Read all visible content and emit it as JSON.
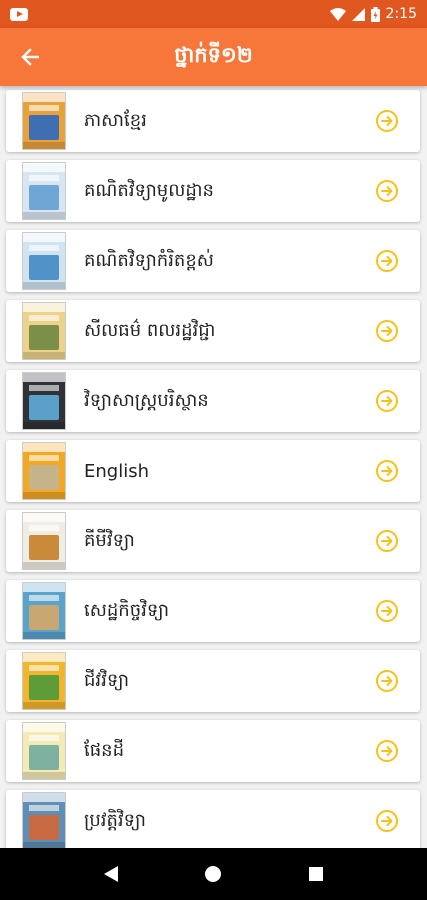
{
  "status_bar": {
    "time": "2:15",
    "icons": [
      "youtube-icon",
      "wifi-icon",
      "signal-icon",
      "battery-icon"
    ]
  },
  "app_bar": {
    "title": "ថ្នាក់ទី១២",
    "back_icon": "arrow-left-icon"
  },
  "colors": {
    "status_bar": "#e0571f",
    "app_bar": "#f7773a",
    "arrow_accent": "#f4c21b"
  },
  "subjects": [
    {
      "label": "ភាសាខ្មែរ",
      "cover_color": "#e9a23b",
      "art_color": "#3e6fb3"
    },
    {
      "label": "គណិតវិទ្យាមូលដ្ឋាន",
      "cover_color": "#d8e6f2",
      "art_color": "#6fa6d6"
    },
    {
      "label": "គណិតវិទ្យាកំរិតខ្ពស់",
      "cover_color": "#cfe3f0",
      "art_color": "#4f93c9"
    },
    {
      "label": "សីលធម៌ ពលរដ្ឋវិជ្ជា",
      "cover_color": "#ecd28a",
      "art_color": "#7c8f4a"
    },
    {
      "label": "វិទ្យាសាស្ត្របរិស្ថាន",
      "cover_color": "#2f3236",
      "art_color": "#5aa0c8"
    },
    {
      "label": "English",
      "cover_color": "#f3a824",
      "art_color": "#c7b38a"
    },
    {
      "label": "គីមីវិទ្យា",
      "cover_color": "#f0ede4",
      "art_color": "#c98a3a"
    },
    {
      "label": "សេដ្ឋកិច្ចវិទ្យា",
      "cover_color": "#5aa4cc",
      "art_color": "#c9a772"
    },
    {
      "label": "ជីវវិទ្យា",
      "cover_color": "#f2b52c",
      "art_color": "#5e9c3a"
    },
    {
      "label": "ផែនដី",
      "cover_color": "#f4eab6",
      "art_color": "#7fb1a0"
    },
    {
      "label": "ប្រវត្តិវិទ្យា",
      "cover_color": "#5f8fb4",
      "art_color": "#c86a44"
    }
  ],
  "nav_bar": {
    "buttons": [
      "back-triangle-icon",
      "home-circle-icon",
      "recents-square-icon"
    ]
  }
}
